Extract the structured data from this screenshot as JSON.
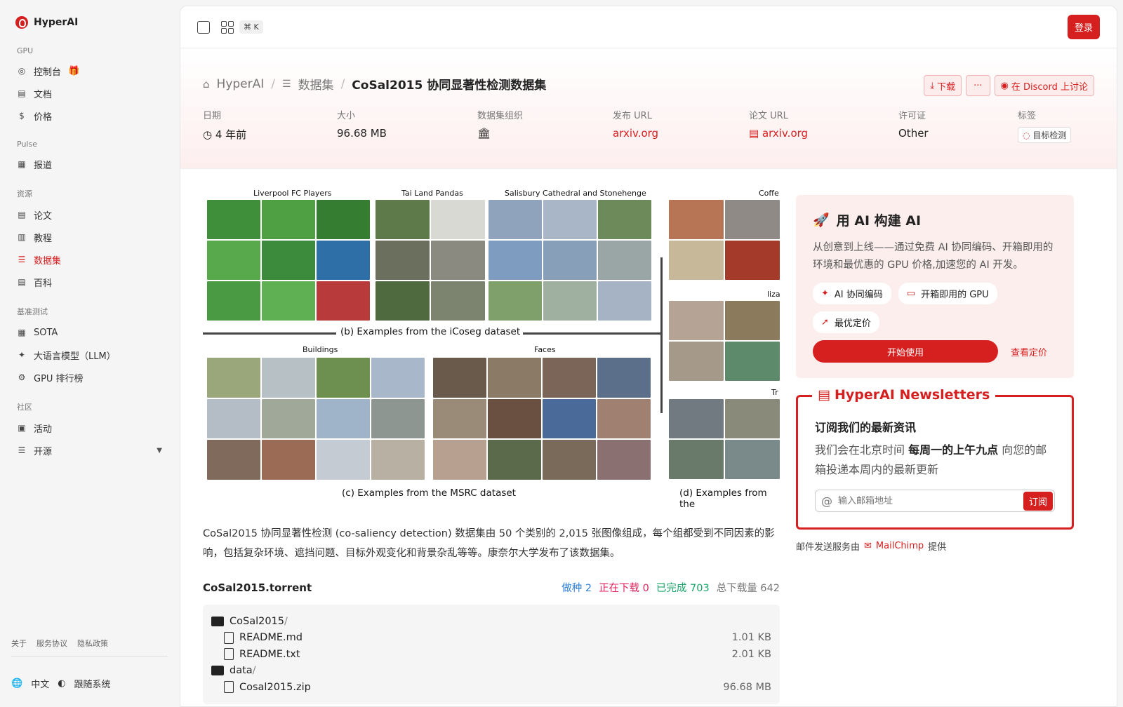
{
  "sidebar": {
    "brand": "HyperAI",
    "sections": [
      {
        "title": "GPU",
        "items": [
          {
            "label": "控制台",
            "icon": "dashboard-icon"
          },
          {
            "label": "文档",
            "icon": "doc-icon"
          },
          {
            "label": "价格",
            "icon": "dollar-icon"
          }
        ]
      },
      {
        "title": "Pulse",
        "items": [
          {
            "label": "报道",
            "icon": "news-icon"
          }
        ]
      },
      {
        "title": "资源",
        "items": [
          {
            "label": "论文",
            "icon": "paper-icon"
          },
          {
            "label": "教程",
            "icon": "book-icon"
          },
          {
            "label": "数据集",
            "icon": "database-icon",
            "active": true
          },
          {
            "label": "百科",
            "icon": "wiki-icon"
          }
        ]
      },
      {
        "title": "基准测试",
        "items": [
          {
            "label": "SOTA",
            "icon": "chart-icon"
          },
          {
            "label": "大语言模型（LLM）",
            "icon": "sparkle-icon"
          },
          {
            "label": "GPU 排行榜",
            "icon": "gpu-icon"
          }
        ]
      },
      {
        "title": "社区",
        "items": [
          {
            "label": "活动",
            "icon": "calendar-icon"
          },
          {
            "label": "开源",
            "icon": "menu-icon"
          }
        ]
      }
    ],
    "footer_links": [
      "关于",
      "服务协议",
      "隐私政策"
    ],
    "language": "中文",
    "theme": "跟随系统"
  },
  "topbar": {
    "shortcut": "⌘ K",
    "login": "登录"
  },
  "breadcrumb": {
    "home": "HyperAI",
    "section": "数据集",
    "current": "CoSal2015 协同显著性检测数据集"
  },
  "actions": {
    "download": "下载",
    "more": "···",
    "discord": "在 Discord 上讨论"
  },
  "meta": {
    "date_label": "日期",
    "date_value": "4 年前",
    "size_label": "大小",
    "size_value": "96.68 MB",
    "org_label": "数据集组织",
    "pub_url_label": "发布 URL",
    "pub_url_value": "arxiv.org",
    "paper_url_label": "论文 URL",
    "paper_url_value": "arxiv.org",
    "license_label": "许可证",
    "license_value": "Other",
    "tags_label": "标签",
    "tag_value": "目标检测"
  },
  "figure": {
    "titles": [
      "Liverpool FC Players",
      "Tai Land Pandas",
      "Salisbury Cathedral and Stonehenge",
      "Coffe",
      "liza",
      "Buildings",
      "Faces",
      "Tr"
    ],
    "caption_b": "(b) Examples from the iCoseg dataset",
    "caption_c": "(c) Examples from the MSRC dataset",
    "caption_d": "(d) Examples from the"
  },
  "description": "CoSal2015 协同显著性检测 (co-saliency detection) 数据集由 50 个类别的 2,015 张图像组成，每个组都受到不同因素的影响，包括复杂环境、遮挡问题、目标外观变化和背景杂乱等等。康奈尔大学发布了该数据集。",
  "torrent": {
    "name": "CoSal2015.torrent",
    "seeding": "做种 2",
    "downloading": "正在下载 0",
    "completed": "已完成 703",
    "total": "总下载量 642",
    "files": [
      {
        "name": "CoSal2015",
        "suffix": "/",
        "type": "folder",
        "size": "",
        "indent": 0
      },
      {
        "name": "README.md",
        "suffix": "",
        "type": "file",
        "size": "1.01 KB",
        "indent": 1
      },
      {
        "name": "README.txt",
        "suffix": "",
        "type": "file",
        "size": "2.01 KB",
        "indent": 1
      },
      {
        "name": "data",
        "suffix": "/",
        "type": "folder",
        "size": "",
        "indent": 0
      },
      {
        "name": "Cosal2015.zip",
        "suffix": "",
        "type": "file",
        "size": "96.68 MB",
        "indent": 1
      }
    ]
  },
  "promo": {
    "title": "用 AI 构建 AI",
    "text": "从创意到上线——通过免费 AI 协同编码、开箱即用的环境和最优惠的 GPU 价格,加速您的 AI 开发。",
    "chips": [
      "AI 协同编码",
      "开箱即用的 GPU",
      "最优定价"
    ],
    "start": "开始使用",
    "pricing": "查看定价"
  },
  "newsletter": {
    "title": "HyperAI Newsletters",
    "heading": "订阅我们的最新资讯",
    "text_pre": "我们会在北京时间 ",
    "text_bold": "每周一的上午九点",
    "text_post": " 向您的邮箱投递本周内的最新更新",
    "placeholder": "输入邮箱地址",
    "subscribe": "订阅",
    "mail_pre": "邮件发送服务由",
    "mail_brand": "MailChimp",
    "mail_post": "提供"
  },
  "colors": {
    "accent": "#d61f1f",
    "seeding": "#2f7fd8",
    "downloading": "#e0245e",
    "completed": "#17a567"
  }
}
